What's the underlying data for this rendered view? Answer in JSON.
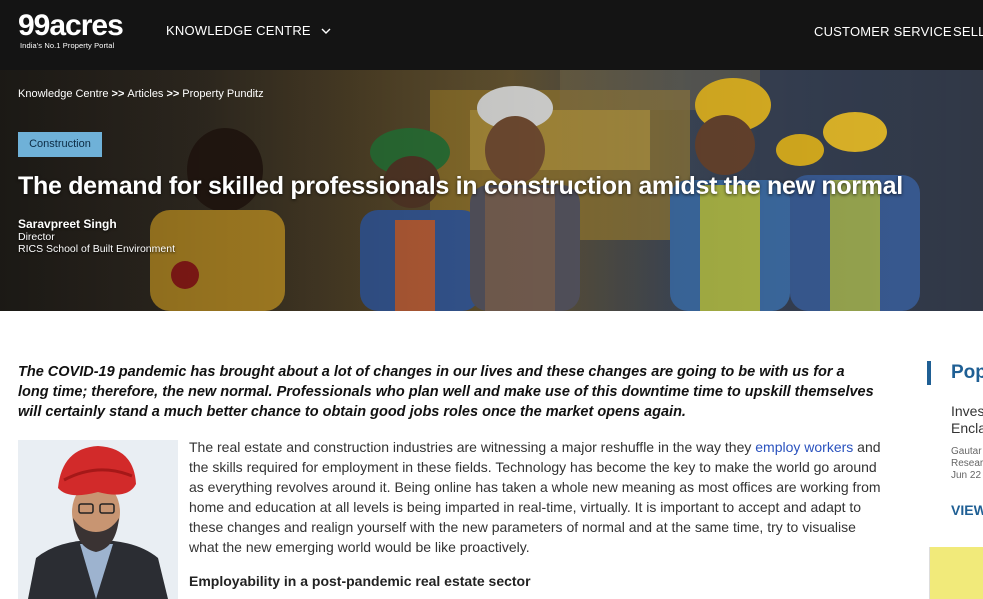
{
  "header": {
    "logo": {
      "name": "99acres",
      "tagline": "India's No.1 Property Portal"
    },
    "nav_knowledge_centre": "KNOWLEDGE CENTRE",
    "nav_customer_service": "CUSTOMER SERVICE",
    "nav_sell": "SELL"
  },
  "breadcrumb": {
    "items": [
      "Knowledge Centre",
      "Articles",
      "Property Punditz"
    ],
    "separator": ">>"
  },
  "article": {
    "category": "Construction",
    "title": "The demand for skilled professionals in construction amidst the new normal",
    "author_name": "Saravpreet Singh",
    "author_title": "Director",
    "author_org": "RICS School of Built Environment",
    "intro": "The COVID-19 pandemic has brought about a lot of changes in our lives and these changes are going to be with us for a long time; therefore, the new normal. Professionals who plan well and make use of this downtime time to upskill themselves will certainly stand a much better chance to obtain good jobs roles once the market opens again.",
    "body_before_link": "The real estate and construction industries are witnessing a major reshuffle in the way they ",
    "body_link": "employ workers",
    "body_after_link": " and the skills required for employment in these fields. Technology has become the key to make the world go around as everything revolves around it. Being online has taken a whole new meaning as most offices are working from home and education at all levels is being imparted in real-time, virtually. It is important to accept and adapt to these changes and realign yourself with the new parameters of normal and at the same time, try to visualise what the new emerging world would be like proactively.",
    "subheading": "Employability in a post-pandemic real estate sector"
  },
  "sidebar": {
    "heading": "Pop",
    "item_title_line1": "Inves",
    "item_title_line2": "Encla",
    "item_meta_line1": "Gautar",
    "item_meta_line2": "Resear",
    "item_meta_line3": "Jun 22",
    "view_label": "VIEW"
  },
  "colors": {
    "header_bg": "#141414",
    "tag_bg": "#6fb1d8",
    "link": "#2a52be",
    "sidebar_accent": "#1f5f94"
  }
}
